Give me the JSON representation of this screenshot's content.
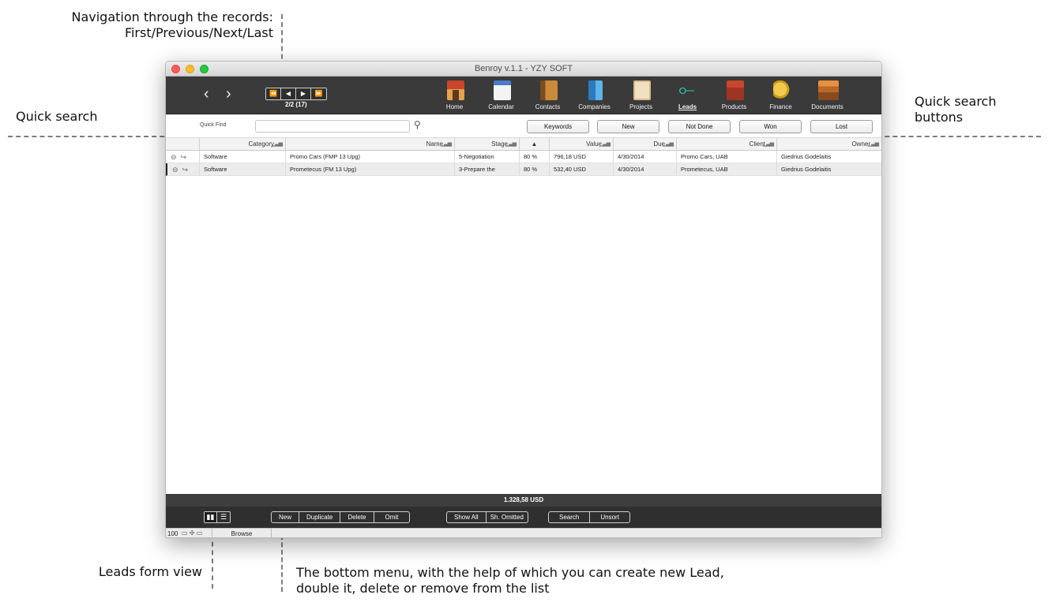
{
  "annotations": {
    "nav_line1": "Navigation through the records:",
    "nav_line2": "First/Previous/Next/Last",
    "quick_search": "Quick search",
    "qs_buttons_line1": "Quick search",
    "qs_buttons_line2": "buttons",
    "leads_form_view": "Leads form view",
    "bottom_menu_line1": "The bottom menu, with the help of which you can create new Lead,",
    "bottom_menu_line2": "double it, delete or remove from the list"
  },
  "window": {
    "title": "Benroy v.1.1 - YZY SOFT"
  },
  "toolbar": {
    "back": "‹",
    "forward": "›",
    "record_nav": {
      "first": "⏪",
      "prev": "◀",
      "next": "▶",
      "last": "⏩"
    },
    "record_count": "2/2 (17)",
    "modules": [
      {
        "label": "Home",
        "icon": "home-icon"
      },
      {
        "label": "Calendar",
        "icon": "calendar-icon"
      },
      {
        "label": "Contacts",
        "icon": "contacts-icon"
      },
      {
        "label": "Companies",
        "icon": "companies-icon"
      },
      {
        "label": "Projects",
        "icon": "projects-icon"
      },
      {
        "label": "Leads",
        "icon": "leads-icon",
        "active": true
      },
      {
        "label": "Products",
        "icon": "products-icon"
      },
      {
        "label": "Finance",
        "icon": "finance-icon"
      },
      {
        "label": "Documents",
        "icon": "documents-icon"
      }
    ]
  },
  "quick_find": {
    "label": "Quick Find",
    "value": "",
    "buttons": [
      "Keywords",
      "New",
      "Not Done",
      "Won",
      "Lost"
    ]
  },
  "table": {
    "headers": [
      "Category",
      "Name",
      "Stage",
      "▲",
      "Value",
      "Due",
      "Client",
      "Owner"
    ],
    "rows": [
      [
        "Software",
        "Promo Cars (FMP 13 Upg)",
        "5-Negotiation",
        "80 %",
        "796,18 USD",
        "4/30/2014",
        "Promo Cars, UAB",
        "Giedrius Godelaitis"
      ],
      [
        "Software",
        "Prometecus (FM 13 Upg)",
        "3-Prepare the",
        "80 %",
        "532,40 USD",
        "4/30/2014",
        "Prometecus, UAB",
        "Giedrius Godelaitis"
      ]
    ]
  },
  "footer": {
    "total": "1.328,58 USD",
    "group1": [
      "New",
      "Duplicate",
      "Delete",
      "Omit"
    ],
    "group2": [
      "Show All",
      "Sh. Omitted"
    ],
    "group3": [
      "Search",
      "Unsort"
    ]
  },
  "status": {
    "zoom": "100",
    "mode": "Browse"
  },
  "colors": {
    "toolbar_bg": "#3a3a3a",
    "accent_leads": "#2fc8c0"
  }
}
